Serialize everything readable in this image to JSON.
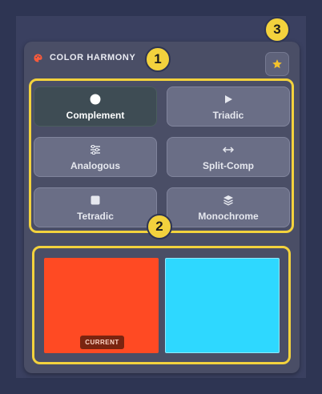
{
  "header": {
    "title": "COLOR HARMONY",
    "icon": "palette-icon",
    "favorite_icon": "star-icon"
  },
  "modes": [
    {
      "label": "Complement",
      "icon": "circle-icon",
      "active": true
    },
    {
      "label": "Triadic",
      "icon": "play-icon",
      "active": false
    },
    {
      "label": "Analogous",
      "icon": "sliders-icon",
      "active": false
    },
    {
      "label": "Split-Comp",
      "icon": "arrows-horizontal-icon",
      "active": false
    },
    {
      "label": "Tetradic",
      "icon": "square-icon",
      "active": false
    },
    {
      "label": "Monochrome",
      "icon": "layers-icon",
      "active": false
    }
  ],
  "swatches": [
    {
      "color": "#ff4a23",
      "badge": "CURRENT"
    },
    {
      "color": "#2ed8ff"
    }
  ],
  "markers": [
    "1",
    "2",
    "3"
  ],
  "colors": {
    "highlight": "#f3d23d",
    "panel": "#4a4e66",
    "background": "#2e3553"
  }
}
